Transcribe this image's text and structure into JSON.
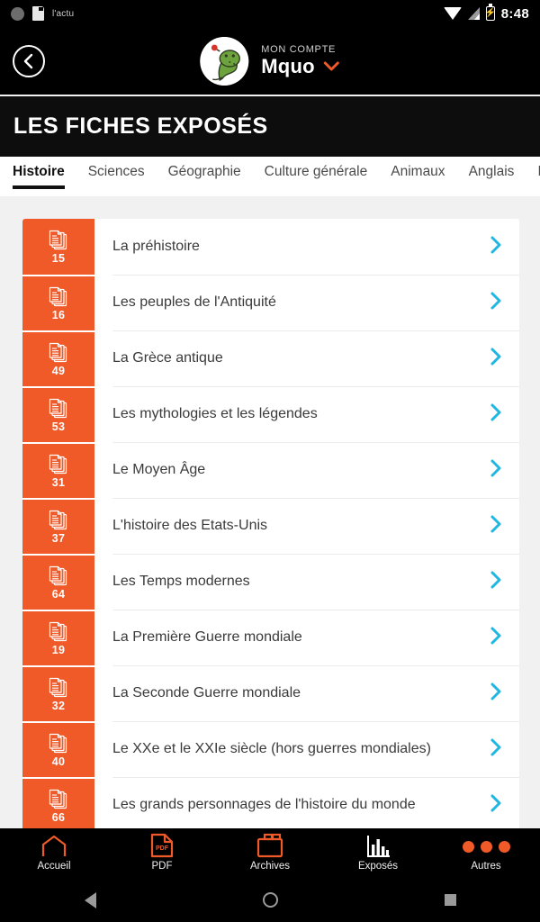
{
  "status_bar": {
    "notification_text": "l'actu",
    "icons": [
      "circle-notification-icon",
      "sd-card-icon",
      "wifi-icon",
      "cellular-signal-icon",
      "battery-charging-icon"
    ],
    "time": "8:48"
  },
  "app_bar": {
    "back_label": "back-arrow",
    "account_label": "MON COMPTE",
    "account_name": "Mquo",
    "dropdown_icon": "chevron-down-icon",
    "avatar_alt": "dinosaur-avatar"
  },
  "page": {
    "title": "LES FICHES EXPOSÉS"
  },
  "tabs": {
    "active_index": 0,
    "items": [
      {
        "label": "Histoire"
      },
      {
        "label": "Sciences"
      },
      {
        "label": "Géographie"
      },
      {
        "label": "Culture générale"
      },
      {
        "label": "Animaux"
      },
      {
        "label": "Anglais"
      },
      {
        "label": "Inst"
      }
    ]
  },
  "list": {
    "tile_color": "#ef5a28",
    "chevron_color": "#1fb6e0",
    "items": [
      {
        "count": "15",
        "title": "La préhistoire"
      },
      {
        "count": "16",
        "title": "Les peuples de l'Antiquité"
      },
      {
        "count": "49",
        "title": "La Grèce antique"
      },
      {
        "count": "53",
        "title": "Les mythologies et les légendes"
      },
      {
        "count": "31",
        "title": "Le Moyen Âge"
      },
      {
        "count": "37",
        "title": "L'histoire des Etats-Unis"
      },
      {
        "count": "64",
        "title": "Les Temps modernes"
      },
      {
        "count": "19",
        "title": "La Première Guerre mondiale"
      },
      {
        "count": "32",
        "title": "La Seconde Guerre mondiale"
      },
      {
        "count": "40",
        "title": "Le XXe et le XXIe siècle (hors guerres mondiales)"
      },
      {
        "count": "66",
        "title": "Les grands personnages de l'histoire du monde"
      }
    ]
  },
  "bottom_nav": {
    "active_index": 3,
    "items": [
      {
        "label": "Accueil",
        "icon": "home-icon"
      },
      {
        "label": "PDF",
        "icon": "pdf-file-icon"
      },
      {
        "label": "Archives",
        "icon": "archive-box-icon"
      },
      {
        "label": "Exposés",
        "icon": "bar-chart-icon"
      },
      {
        "label": "Autres",
        "icon": "more-dots-icon"
      }
    ]
  },
  "system_nav": {
    "back": "android-back-icon",
    "home": "android-home-icon",
    "recents": "android-recents-icon"
  }
}
